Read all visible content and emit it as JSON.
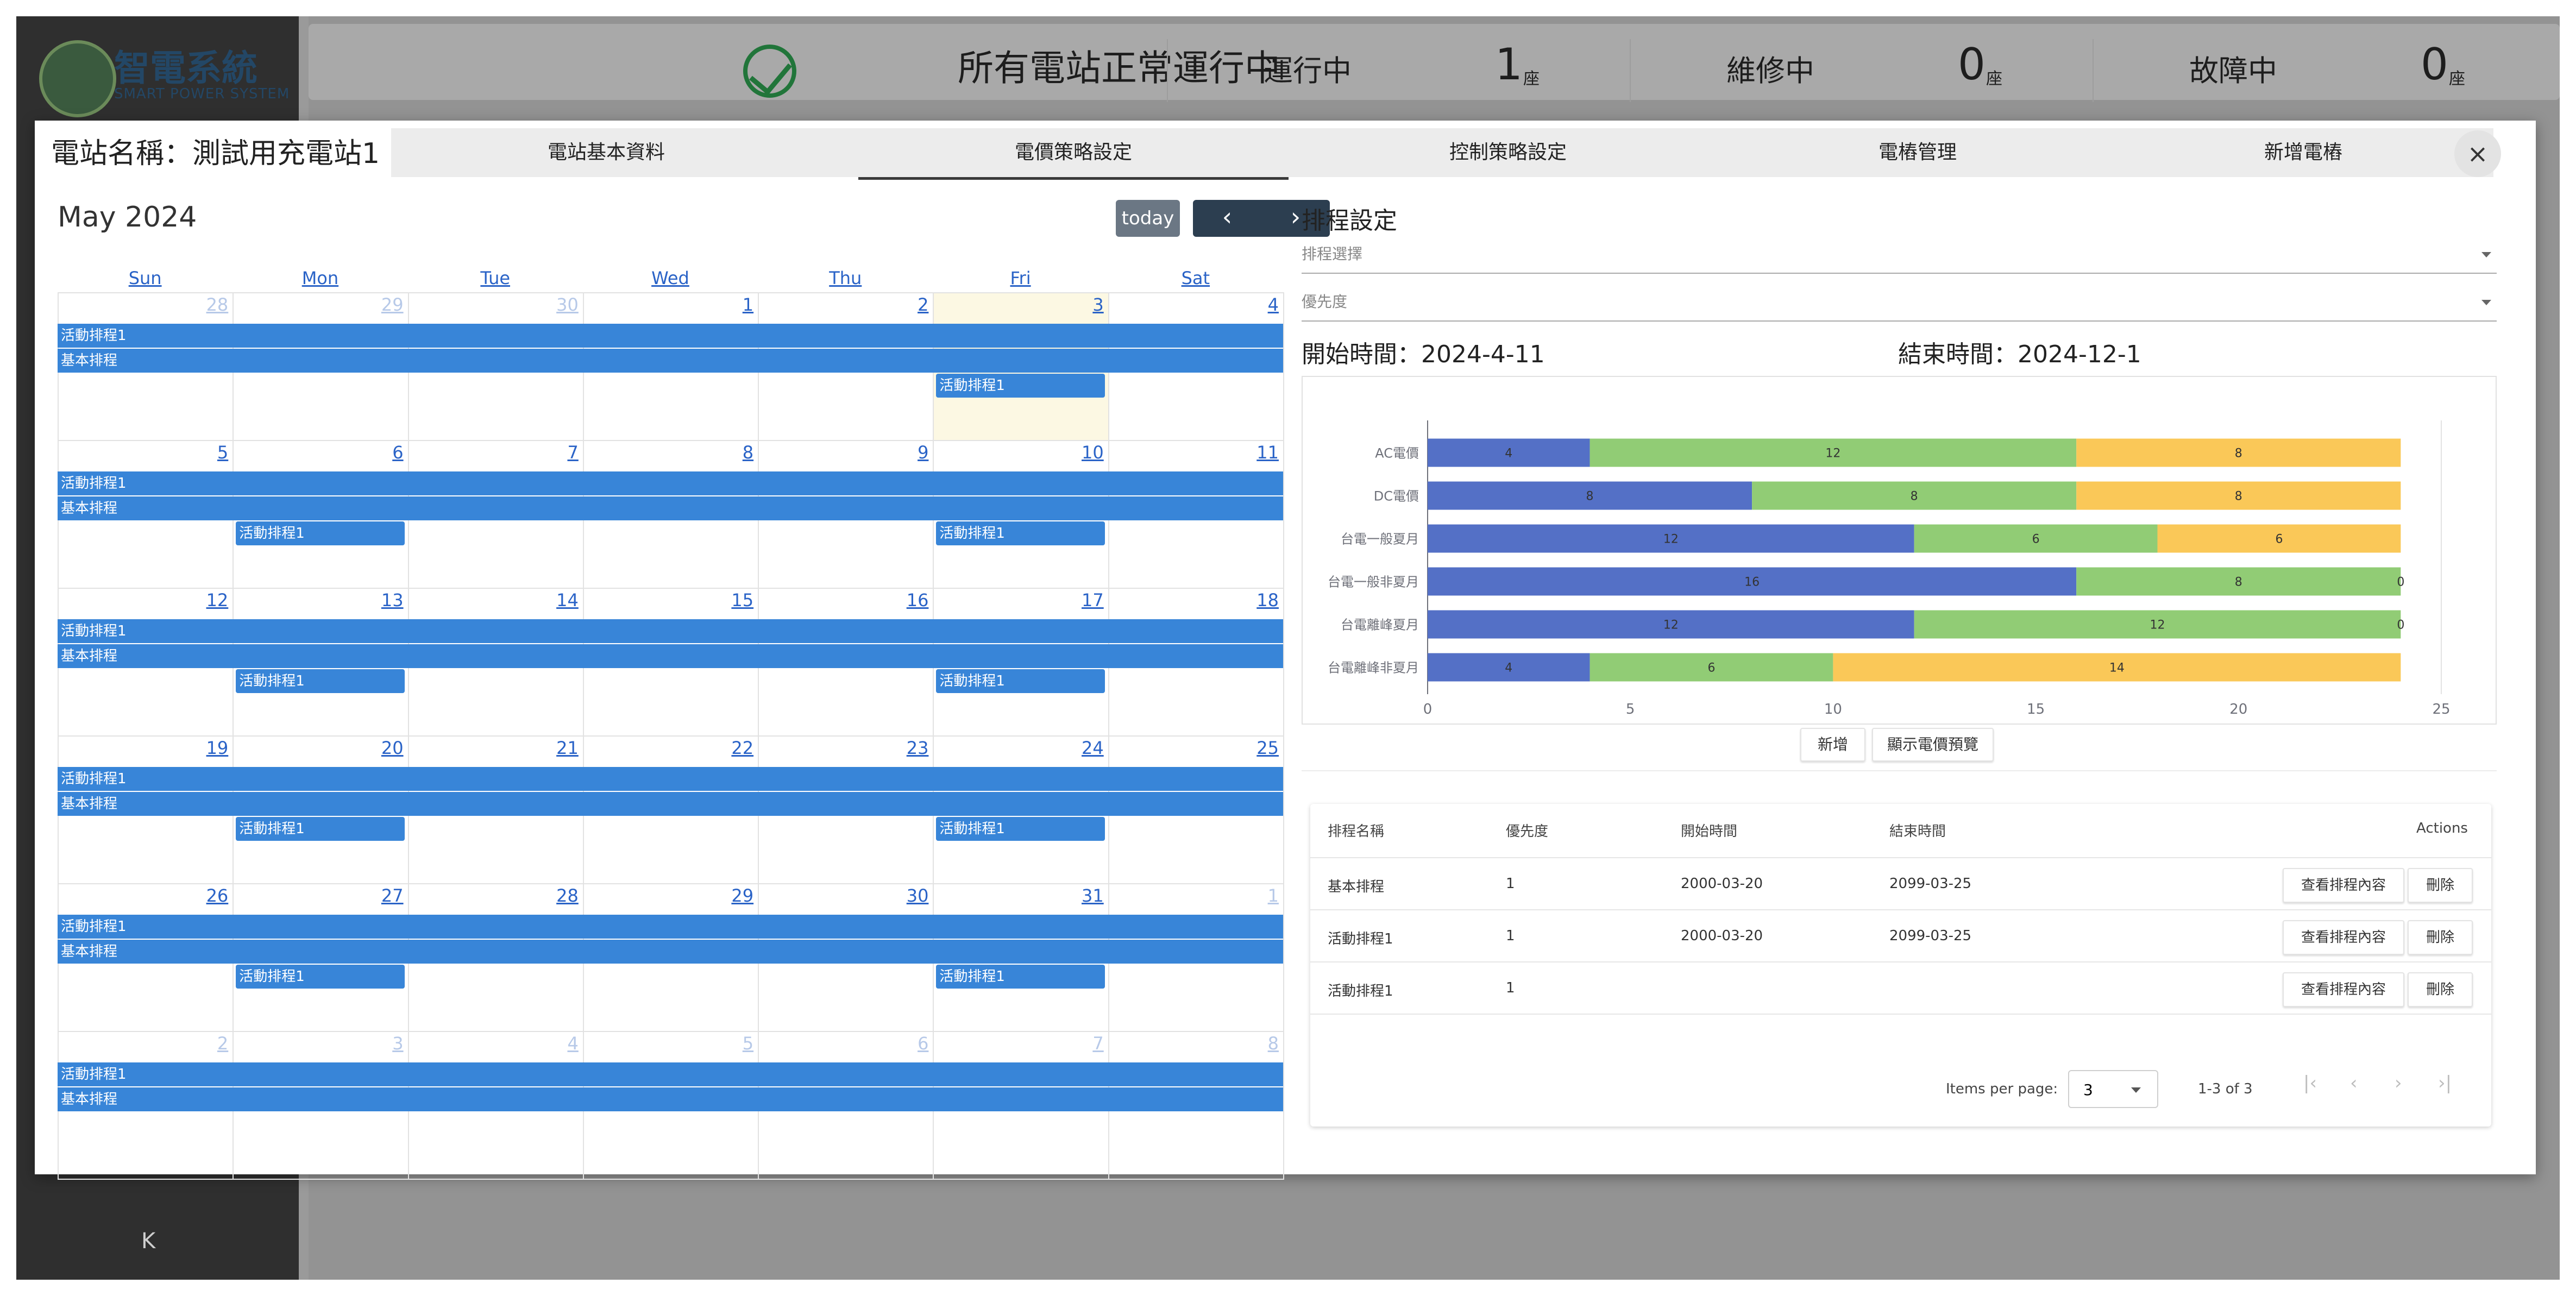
{
  "sidebar": {
    "logo_title": "智電系統",
    "logo_subtitle": "SMART POWER SYSTEM",
    "collapse_label": "K"
  },
  "status": {
    "message": "所有電站正常運行中",
    "running_label": "運行中",
    "running_count": "1",
    "maintenance_label": "維修中",
    "maintenance_count": "0",
    "fault_label": "故障中",
    "fault_count": "0",
    "unit": "座"
  },
  "modal": {
    "title": "電站名稱：測試用充電站1",
    "close_label": "×",
    "tabs": [
      "電站基本資料",
      "電價策略設定",
      "控制策略設定",
      "電樁管理",
      "新增電樁"
    ],
    "active_tab": 1
  },
  "calendar": {
    "title": "May 2024",
    "today_label": "today",
    "prev_label": "‹",
    "next_label": "›",
    "weekdays": [
      "Sun",
      "Mon",
      "Tue",
      "Wed",
      "Thu",
      "Fri",
      "Sat"
    ],
    "weeks": [
      [
        "28",
        "29",
        "30",
        "1",
        "2",
        "3",
        "4"
      ],
      [
        "5",
        "6",
        "7",
        "8",
        "9",
        "10",
        "11"
      ],
      [
        "12",
        "13",
        "14",
        "15",
        "16",
        "17",
        "18"
      ],
      [
        "19",
        "20",
        "21",
        "22",
        "23",
        "24",
        "25"
      ],
      [
        "26",
        "27",
        "28",
        "29",
        "30",
        "31",
        "1"
      ],
      [
        "2",
        "3",
        "4",
        "5",
        "6",
        "7",
        "8"
      ]
    ],
    "event_a": "活動排程1",
    "event_b": "基本排程"
  },
  "schedule": {
    "title": "排程設定",
    "select_placeholder": "排程選擇",
    "priority_placeholder": "優先度",
    "start_time": "開始時間：2024-4-11",
    "end_time": "結束時間：2024-12-1",
    "add_button": "新增",
    "preview_button": "顯示電價預覽"
  },
  "chart_data": {
    "type": "bar",
    "orientation": "horizontal",
    "stacked": true,
    "categories": [
      "AC電價",
      "DC電價",
      "台電一般夏月",
      "台電一般非夏月",
      "台電離峰夏月",
      "台電離峰非夏月"
    ],
    "series": [
      {
        "values": [
          4,
          8,
          12,
          16,
          12,
          4
        ],
        "color": "#5470c6"
      },
      {
        "values": [
          12,
          8,
          6,
          8,
          12,
          6
        ],
        "color": "#91cc75"
      },
      {
        "values": [
          8,
          8,
          6,
          0,
          0,
          14
        ],
        "color": "#fac858"
      }
    ],
    "xlim": [
      0,
      25
    ],
    "xticks": [
      "0",
      "5",
      "10",
      "15",
      "20",
      "25"
    ],
    "grid": true
  },
  "table": {
    "headers": [
      "排程名稱",
      "優先度",
      "開始時間",
      "結束時間",
      "Actions"
    ],
    "rows": [
      {
        "name": "基本排程",
        "priority": "1",
        "start": "2000-03-20",
        "end": "2099-03-25"
      },
      {
        "name": "活動排程1",
        "priority": "1",
        "start": "2000-03-20",
        "end": "2099-03-25"
      },
      {
        "name": "活動排程1",
        "priority": "1",
        "start": "",
        "end": ""
      }
    ],
    "view_button": "查看排程內容",
    "delete_button": "刪除",
    "items_per_page_label": "Items per page:",
    "items_per_page": "3",
    "range": "1-3 of 3",
    "first_label": "|‹",
    "prev_label": "‹",
    "next_label": "›",
    "last_label": "›|"
  }
}
